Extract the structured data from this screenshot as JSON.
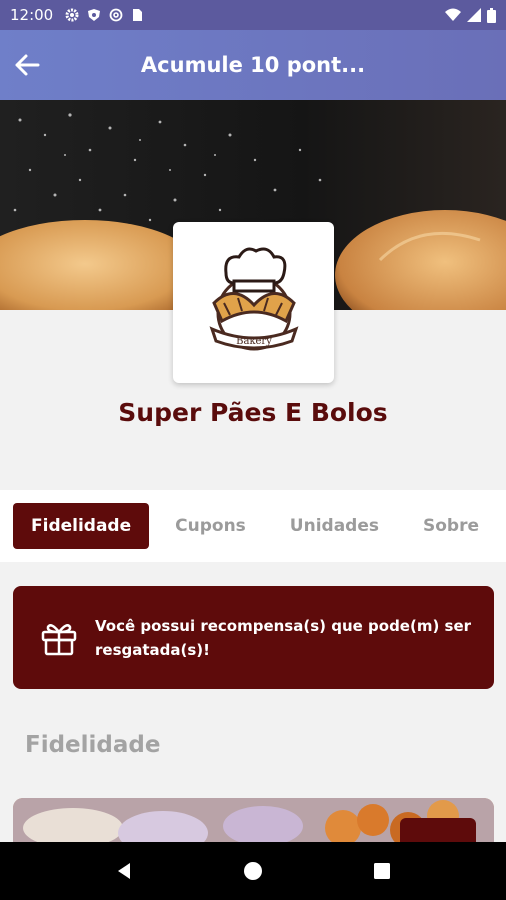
{
  "status_bar": {
    "time": "12:00",
    "left_icons": [
      "gear-icon",
      "shield-icon",
      "at-icon",
      "sim-card-icon"
    ],
    "right_icons": [
      "wifi-icon",
      "signal-icon",
      "battery-icon"
    ]
  },
  "app_bar": {
    "title": "Acumule 10 pont...",
    "back_icon": "arrow-left-icon"
  },
  "store": {
    "name": "Super Pães E Bolos",
    "logo_text": "Bakery",
    "logo_icon": "chef-hat-icon"
  },
  "tabs": [
    {
      "label": "Fidelidade",
      "active": true
    },
    {
      "label": "Cupons",
      "active": false
    },
    {
      "label": "Unidades",
      "active": false
    },
    {
      "label": "Sobre",
      "active": false
    }
  ],
  "reward_banner": {
    "icon": "gift-icon",
    "text": "Você possui recompensa(s) que pode(m) ser resgatada(s)!"
  },
  "section": {
    "title": "Fidelidade"
  },
  "colors": {
    "primary": "#5e0b0b",
    "app_bar": "#6f7fc9",
    "status_bar": "#5c5a9e",
    "background": "#f2f2f2"
  },
  "nav_bar": {
    "icons": [
      "back-triangle-icon",
      "home-circle-icon",
      "recents-square-icon"
    ]
  }
}
